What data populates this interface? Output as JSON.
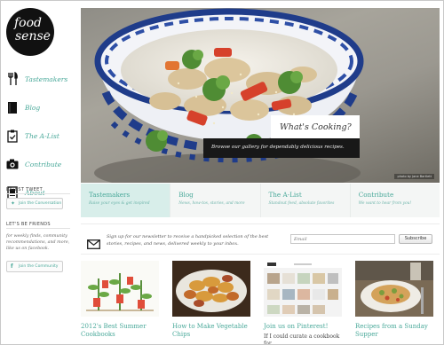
{
  "logo": {
    "line1": "food",
    "line2": "sense",
    "tm": "™"
  },
  "nav": [
    {
      "label": "Tastemakers",
      "icon": "utensils-icon"
    },
    {
      "label": "Blog",
      "icon": "book-icon"
    },
    {
      "label": "The A-List",
      "icon": "checklist-icon"
    },
    {
      "label": "Contribute",
      "icon": "camera-icon"
    },
    {
      "label": "About",
      "icon": "info-icon"
    }
  ],
  "sidebar": {
    "latest_tweet_heading": "LATEST TWEET",
    "join_conversation": "Join the Conversation",
    "lets_be_friends_heading": "LET'S BE FRIENDS",
    "friends_text": "for weekly finds, community recommendations, and more, like us on facebook.",
    "join_community": "Join the Community"
  },
  "hero": {
    "title": "What's Cooking?",
    "subtitle": "Browse our gallery for dependably delicious recipes.",
    "credit": "photo by Jane Bartlett"
  },
  "tabs": [
    {
      "title": "Tastemakers",
      "subtitle": "Raise your eyes & get inspired"
    },
    {
      "title": "Blog",
      "subtitle": "News, how-tos, stories, and more"
    },
    {
      "title": "The A-List",
      "subtitle": "Standout feed, absolute favorites"
    },
    {
      "title": "Contribute",
      "subtitle": "We want to hear from you!"
    }
  ],
  "newsletter": {
    "text": "Sign up for our newsletter to receive a handpicked selection of the best stories, recipes, and news, delivered weekly to your inbox.",
    "email_placeholder": "Email",
    "subscribe_label": "Subscribe"
  },
  "cards": [
    {
      "title": "2012's Best Summer Cookbooks",
      "subtitle": ""
    },
    {
      "title": "How to Make Vegetable Chips",
      "subtitle": ""
    },
    {
      "title": "Join us on Pinterest!",
      "subtitle": "If I could curate a cookbook for"
    },
    {
      "title": "Recipes from a Sunday Supper",
      "subtitle": ""
    }
  ],
  "colors": {
    "accent": "#4aa99a",
    "active_tab": "#d8eeea",
    "dark_banner": "#181818"
  }
}
